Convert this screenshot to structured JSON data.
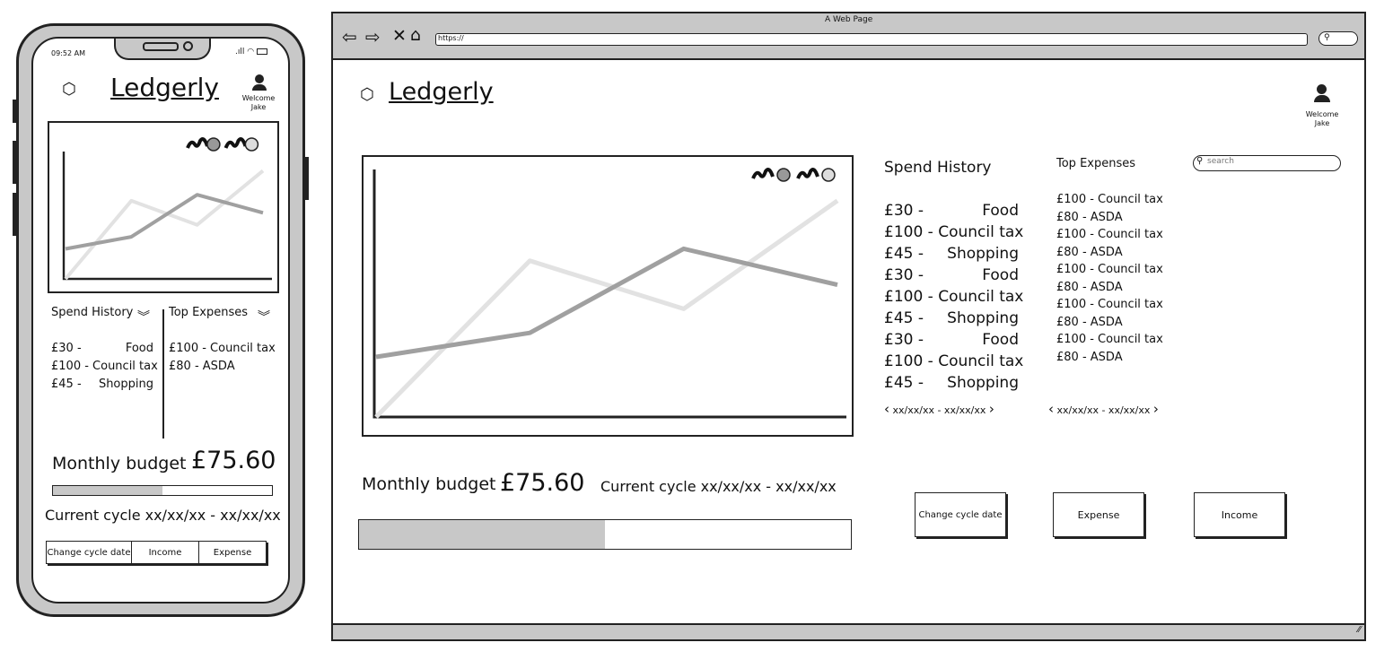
{
  "mobile": {
    "status_time": "09:52 AM",
    "logo": "Ledgerly",
    "welcome": "Welcome",
    "user": "Jake",
    "spend_history": {
      "title": "Spend History",
      "items": [
        {
          "amount": "£30 -",
          "label": "Food"
        },
        {
          "amount": "£100 - Council tax",
          "label": ""
        },
        {
          "amount": "£45 -",
          "label": "Shopping"
        }
      ]
    },
    "top_expenses": {
      "title": "Top Expenses",
      "items": [
        "£100 - Council tax",
        "£80 - ASDA"
      ]
    },
    "budget_label": "Monthly budget",
    "budget_value": "£75.60",
    "budget_progress": 0.5,
    "cycle": "Current cycle xx/xx/xx - xx/xx/xx",
    "buttons": [
      "Change cycle date",
      "Income",
      "Expense"
    ]
  },
  "browser": {
    "window_title": "A Web Page",
    "url": "https://",
    "logo": "Ledgerly",
    "welcome": "Welcome",
    "user": "Jake",
    "spend_history": {
      "title": "Spend History",
      "items": [
        {
          "amount": "£30 -",
          "label": "Food"
        },
        {
          "amount": "£100 - Council tax",
          "label": ""
        },
        {
          "amount": "£45 -",
          "label": "Shopping"
        },
        {
          "amount": "£30 -",
          "label": "Food"
        },
        {
          "amount": "£100 - Council tax",
          "label": ""
        },
        {
          "amount": "£45 -",
          "label": "Shopping"
        },
        {
          "amount": "£30 -",
          "label": "Food"
        },
        {
          "amount": "£100 - Council tax",
          "label": ""
        },
        {
          "amount": "£45 -",
          "label": "Shopping"
        }
      ],
      "range": "xx/xx/xx - xx/xx/xx"
    },
    "top_expenses": {
      "title": "Top Expenses",
      "items": [
        "£100 - Council tax",
        "£80 - ASDA",
        "£100 - Council tax",
        "£80 - ASDA",
        "£100 - Council tax",
        "£80 - ASDA",
        "£100 - Council tax",
        "£80 - ASDA",
        "£100 - Council tax",
        "£80 - ASDA"
      ],
      "range": "xx/xx/xx - xx/xx/xx"
    },
    "search_placeholder": "search",
    "budget_label": "Monthly budget",
    "budget_value": "£75.60",
    "budget_progress": 0.5,
    "cycle": "Current cycle xx/xx/xx - xx/xx/xx",
    "buttons": [
      "Change cycle date",
      "Expense",
      "Income"
    ]
  },
  "chart_data": {
    "type": "line",
    "x": [
      0,
      1,
      2,
      3
    ],
    "series": [
      {
        "values": [
          2.5,
          3.5,
          7,
          5.5
        ],
        "color": "#a0a0a0"
      },
      {
        "values": [
          0,
          6.5,
          4.5,
          9
        ],
        "color": "#e2e2e2"
      }
    ],
    "ylim": [
      0,
      10
    ],
    "legend": "top-right"
  }
}
